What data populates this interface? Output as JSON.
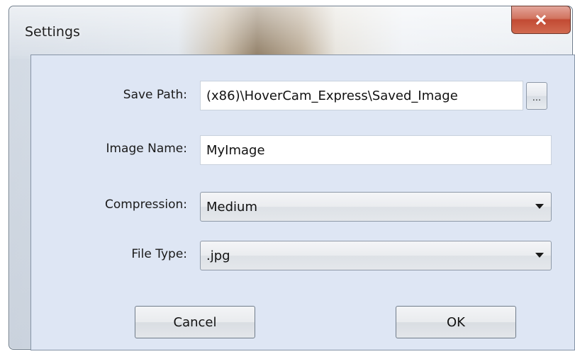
{
  "window": {
    "title": "Settings",
    "close_icon": "close-icon"
  },
  "form": {
    "save_path": {
      "label": "Save Path:",
      "value": "(x86)\\HoverCam_Express\\Saved_Image",
      "browse_label": "..."
    },
    "image_name": {
      "label": "Image Name:",
      "value": "MyImage"
    },
    "compression": {
      "label": "Compression:",
      "selected": "Medium"
    },
    "file_type": {
      "label": "File Type:",
      "selected": ".jpg"
    }
  },
  "buttons": {
    "cancel": "Cancel",
    "ok": "OK"
  },
  "colors": {
    "client_background": "#dee6f4",
    "close_button": "#c24a33"
  }
}
